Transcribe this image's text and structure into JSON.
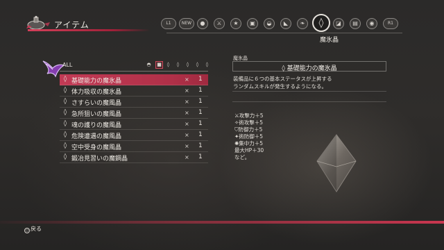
{
  "header": {
    "title": "アイテム"
  },
  "tabs": [
    {
      "icon": "l1-button-icon",
      "label": "L1",
      "kind": "pill"
    },
    {
      "icon": "new-items-icon",
      "label": "NEW",
      "kind": "pill"
    },
    {
      "icon": "consumable-icon",
      "label": "●"
    },
    {
      "icon": "sword-icon",
      "label": "⚔"
    },
    {
      "icon": "star-icon",
      "label": "★"
    },
    {
      "icon": "chest-icon",
      "label": "▣"
    },
    {
      "icon": "bell-icon",
      "label": "◒"
    },
    {
      "icon": "boot-icon",
      "label": "◣"
    },
    {
      "icon": "leaf-icon",
      "label": "❧"
    },
    {
      "icon": "crystal-tab-icon",
      "label": "◊",
      "active": true
    },
    {
      "icon": "jar-icon",
      "label": "◪"
    },
    {
      "icon": "book-icon",
      "label": "▤"
    },
    {
      "icon": "signal-icon",
      "label": "◉"
    },
    {
      "icon": "r1-button-icon",
      "label": "R1",
      "kind": "pill"
    }
  ],
  "active_tab_label": "魔氷晶",
  "list": {
    "filter_label": "ALL",
    "filters": [
      {
        "icon": "filter-helmet-icon",
        "glyph": "◓"
      },
      {
        "icon": "filter-selected-icon",
        "glyph": "■",
        "selected": true
      },
      {
        "icon": "filter-gem-a-icon",
        "glyph": "◊"
      },
      {
        "icon": "filter-gem-b-icon",
        "glyph": "◊"
      },
      {
        "icon": "filter-gem-c-icon",
        "glyph": "◊"
      },
      {
        "icon": "filter-gem-d-icon",
        "glyph": "◊"
      },
      {
        "icon": "filter-gem-e-icon",
        "glyph": "◊"
      }
    ],
    "items": [
      {
        "name": "基礎能力の魔氷晶",
        "qty": "1",
        "selected": true
      },
      {
        "name": "体力吸収の魔氷晶",
        "qty": "1"
      },
      {
        "name": "さすらいの魔風晶",
        "qty": "1"
      },
      {
        "name": "急所狙いの魔風晶",
        "qty": "1"
      },
      {
        "name": "魂の護りの魔風晶",
        "qty": "1"
      },
      {
        "name": "危険遭遇の魔風晶",
        "qty": "1"
      },
      {
        "name": "空中受身の魔風晶",
        "qty": "1"
      },
      {
        "name": "鍛冶見習いの魔鋼晶",
        "qty": "1"
      }
    ],
    "multiply_sign": "×"
  },
  "detail": {
    "category": "魔氷晶",
    "name": "基礎能力の魔氷晶",
    "description": "装備品に６つの基本ステータスが上昇する\nランダムスキルが発生するようになる。",
    "stats": [
      {
        "icon": "attack-stat-icon",
        "text": "攻撃力＋5"
      },
      {
        "icon": "arte-attack-stat-icon",
        "text": "術攻撃＋5"
      },
      {
        "icon": "defense-stat-icon",
        "text": "防御力＋5"
      },
      {
        "icon": "arte-defense-stat-icon",
        "text": "術防御＋5"
      },
      {
        "icon": "focus-stat-icon",
        "text": "集中力＋5"
      },
      {
        "icon": "",
        "text": "最大HP＋30"
      },
      {
        "icon": "",
        "text": "など。"
      }
    ]
  },
  "footer": {
    "back_button": "○",
    "back_label": "戻る"
  },
  "colors": {
    "accent": "#c23a55",
    "background": "#2d2b2a",
    "text": "#e8e6e2"
  }
}
